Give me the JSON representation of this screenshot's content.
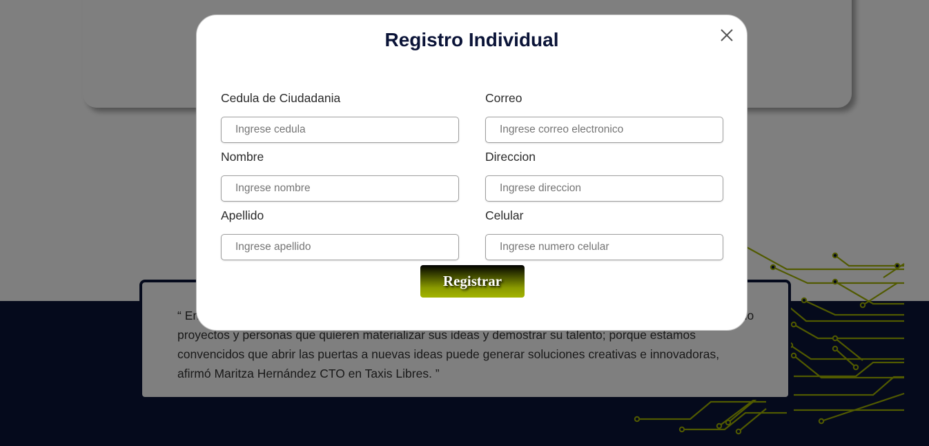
{
  "background": {
    "quote": "“ En Taxis Libres creemos en la innovación como motor de la transformación económica del país, apoyando proyectos y personas que quieren materializar sus ideas y demostrar su talento; porque estamos convencidos que abrir las puertas a nuevas ideas puede generar soluciones creativas e innovadoras, afirmó Maritza Hernández CTO en Taxis Libres. ”"
  },
  "modal": {
    "title": "Registro Individual",
    "close_icon": "close-icon",
    "fields": [
      {
        "label": "Cedula de Ciudadania",
        "placeholder": "Ingrese cedula",
        "value": ""
      },
      {
        "label": "Correo",
        "placeholder": "Ingrese correo electronico",
        "value": ""
      },
      {
        "label": "Nombre",
        "placeholder": "Ingrese nombre",
        "value": ""
      },
      {
        "label": "Direccion",
        "placeholder": "Ingrese direccion",
        "value": ""
      },
      {
        "label": "Apellido",
        "placeholder": "Ingrese apellido",
        "value": ""
      },
      {
        "label": "Celular",
        "placeholder": "Ingrese numero celular",
        "value": ""
      }
    ],
    "submit_label": "Registrar"
  },
  "colors": {
    "navy": "#0b1438",
    "accent_green": "#a3b400",
    "overlay": "rgba(0,0,0,0.5)"
  }
}
